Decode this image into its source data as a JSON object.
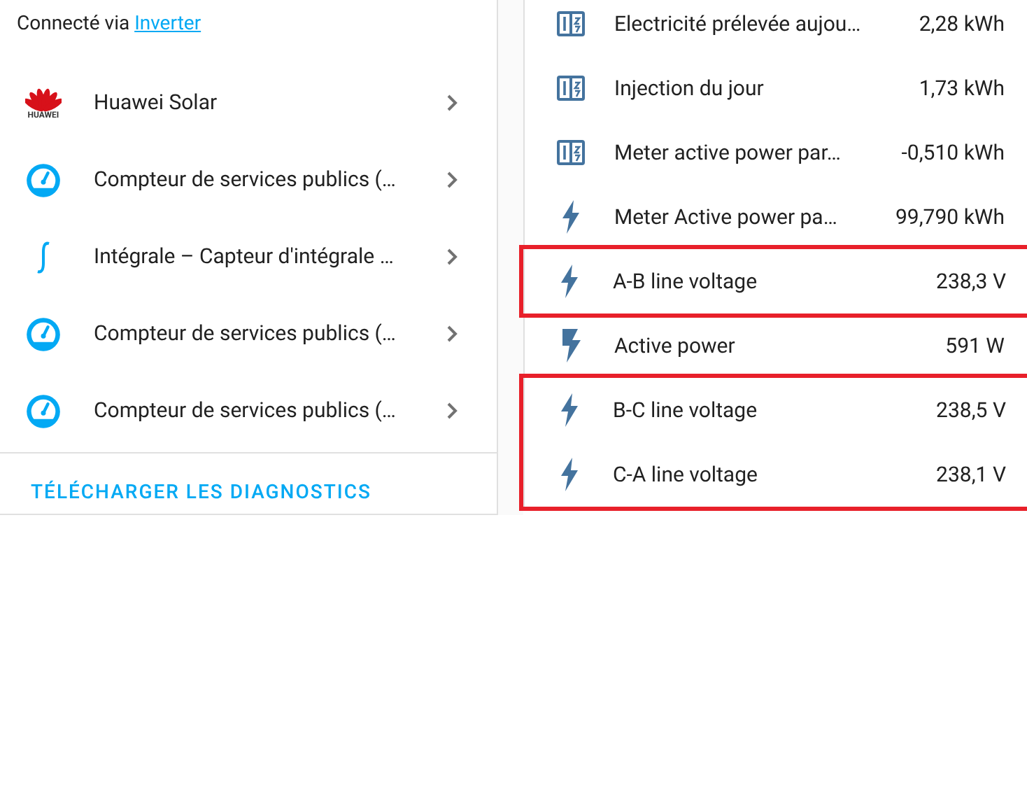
{
  "connection": {
    "prefix": "Connecté via",
    "link": "Inverter"
  },
  "devices": [
    {
      "kind": "huawei",
      "logo_text": "HUAWEI",
      "name": "Huawei Solar"
    },
    {
      "kind": "gauge",
      "name": "Compteur de services publics (…"
    },
    {
      "kind": "integral",
      "name": "Intégrale – Capteur d'intégrale …"
    },
    {
      "kind": "gauge",
      "name": "Compteur de services publics (…"
    },
    {
      "kind": "gauge",
      "name": "Compteur de services publics (…"
    }
  ],
  "diagnostics_button": "TÉLÉCHARGER LES DIAGNOSTICS",
  "entities": [
    {
      "kind": "counter",
      "name": "Electricité prélevée aujou…",
      "value": "2,28 kWh",
      "highlighted": false
    },
    {
      "kind": "counter",
      "name": "Injection du jour",
      "value": "1,73 kWh",
      "highlighted": false
    },
    {
      "kind": "counter",
      "name": "Meter active power par…",
      "value": "-0,510 kWh",
      "highlighted": false
    },
    {
      "kind": "flash",
      "name": "Meter Active power pa…",
      "value": "99,790 kWh",
      "highlighted": false
    },
    {
      "kind": "flash",
      "name": "A-B line voltage",
      "value": "238,3 V",
      "highlighted": true
    },
    {
      "kind": "power",
      "name": "Active power",
      "value": "591 W",
      "highlighted": false
    },
    {
      "kind": "flash",
      "name": "B-C line voltage",
      "value": "238,5 V",
      "highlighted": true
    },
    {
      "kind": "flash",
      "name": "C-A line voltage",
      "value": "238,1 V",
      "highlighted": true
    }
  ]
}
